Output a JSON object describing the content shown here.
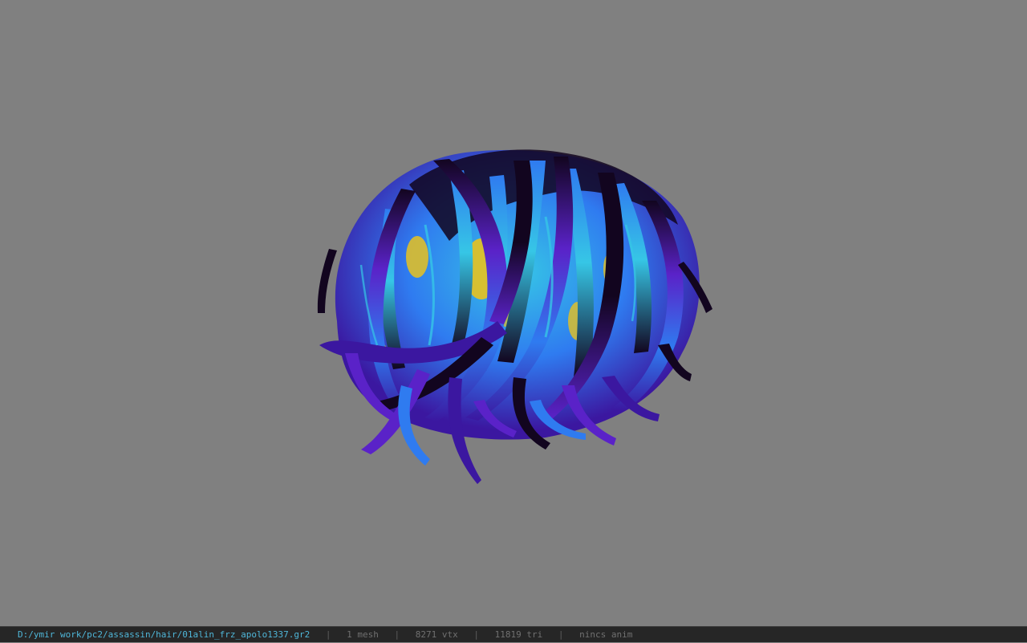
{
  "viewport": {
    "background_color": "#808080",
    "model_palette": {
      "dark": "#12051f",
      "purple": "#5a22c8",
      "violet": "#3b17a0",
      "blue": "#2f7bf0",
      "cyan": "#36c6e6",
      "yellow": "#e8c21e"
    }
  },
  "status_bar": {
    "file_path": "D:/ymir work/pc2/assassin/hair/01alin_frz_apolo1337.gr2",
    "separator": "|",
    "mesh_count": "1 mesh",
    "vertex_count": "8271 vtx",
    "triangle_count": "11819 tri",
    "anim_status": "nincs anim",
    "path_color": "#4fb6d8",
    "background_color": "#262626"
  }
}
